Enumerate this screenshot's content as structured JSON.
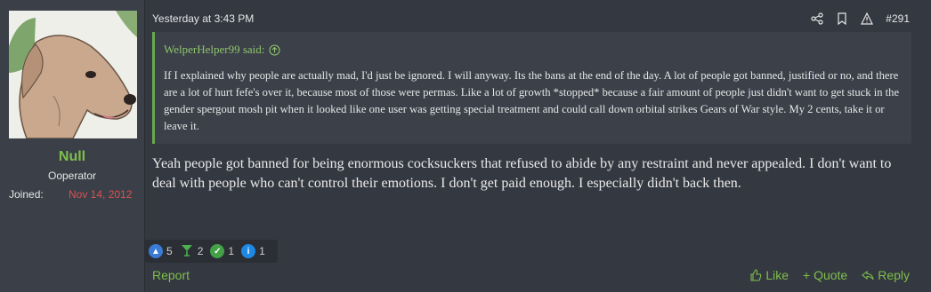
{
  "user": {
    "name": "Null",
    "title": "Ooperator",
    "joined_label": "Joined:",
    "joined_date": "Nov 14, 2012",
    "avatar_icon": "dog-avatar"
  },
  "post": {
    "timestamp": "Yesterday at 3:43 PM",
    "number": "#291",
    "tool_icons": [
      "share-icon",
      "bookmark-icon",
      "report-icon"
    ],
    "quote": {
      "author_line": "WelperHelper99 said:",
      "body": "If I explained why people are actually mad, I'd just be ignored. I will anyway. Its the bans at the end of the day. A lot of people got banned, justified or no, and there are a lot of hurt fefe's over it, because most of those were permas. Like a lot of growth *stopped* because a fair amount of people just didn't want to get stuck in the gender spergout mosh pit when it looked like one user was getting special treatment and could call down orbital strikes Gears of War style. My 2 cents, take it or leave it."
    },
    "reply": "Yeah people got banned for being enormous cocksuckers that refused to abide by any restraint and never appealed. I don't want to deal with people who can't control their emotions. I don't get paid enough. I especially didn't back then."
  },
  "reactions": [
    {
      "icon": "thumbs-up-icon",
      "count": "5",
      "color": "#3a7bd5"
    },
    {
      "icon": "cocktail-icon",
      "count": "2",
      "color": "#4caf50"
    },
    {
      "icon": "check-icon",
      "count": "1",
      "color": "#43a047"
    },
    {
      "icon": "info-icon",
      "count": "1",
      "color": "#1e88e5"
    }
  ],
  "footer": {
    "report": "Report",
    "like": "Like",
    "quote": "+ Quote",
    "reply": "Reply"
  },
  "colors": {
    "accent_green": "#7fbf4d",
    "joined_red": "#d9534f",
    "background": "#343840"
  }
}
